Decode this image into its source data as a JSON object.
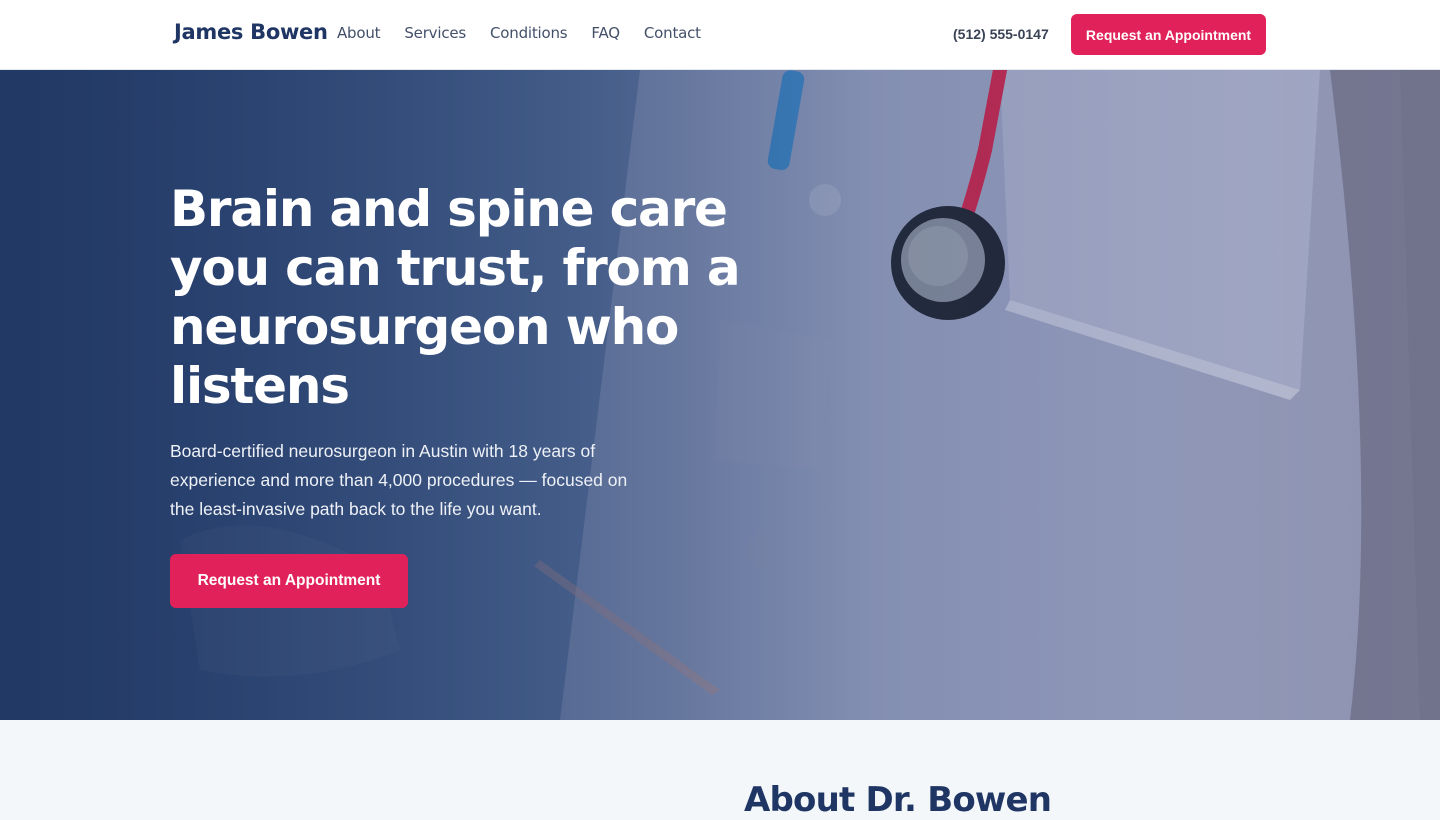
{
  "header": {
    "brand": "James Bowen",
    "nav": [
      "About",
      "Services",
      "Conditions",
      "FAQ",
      "Contact"
    ],
    "phone": "(512) 555-0147",
    "cta_label": "Request an Appointment"
  },
  "hero": {
    "title": "Brain and spine care you can trust, from a neurosurgeon who listens",
    "subtitle": "Board-certified neurosurgeon in Austin with 18 years of experience and more than 4,000 procedures — focused on the least-invasive path back to the life you want.",
    "cta_label": "Request an Appointment",
    "image_subject": "doctor-with-stethoscope-photo"
  },
  "about": {
    "title": "About Dr. Bowen"
  },
  "colors": {
    "brand_navy": "#1f3563",
    "accent": "#e0215a",
    "hero_overlay": "#2b4577",
    "section_bg": "#f3f7fa"
  }
}
